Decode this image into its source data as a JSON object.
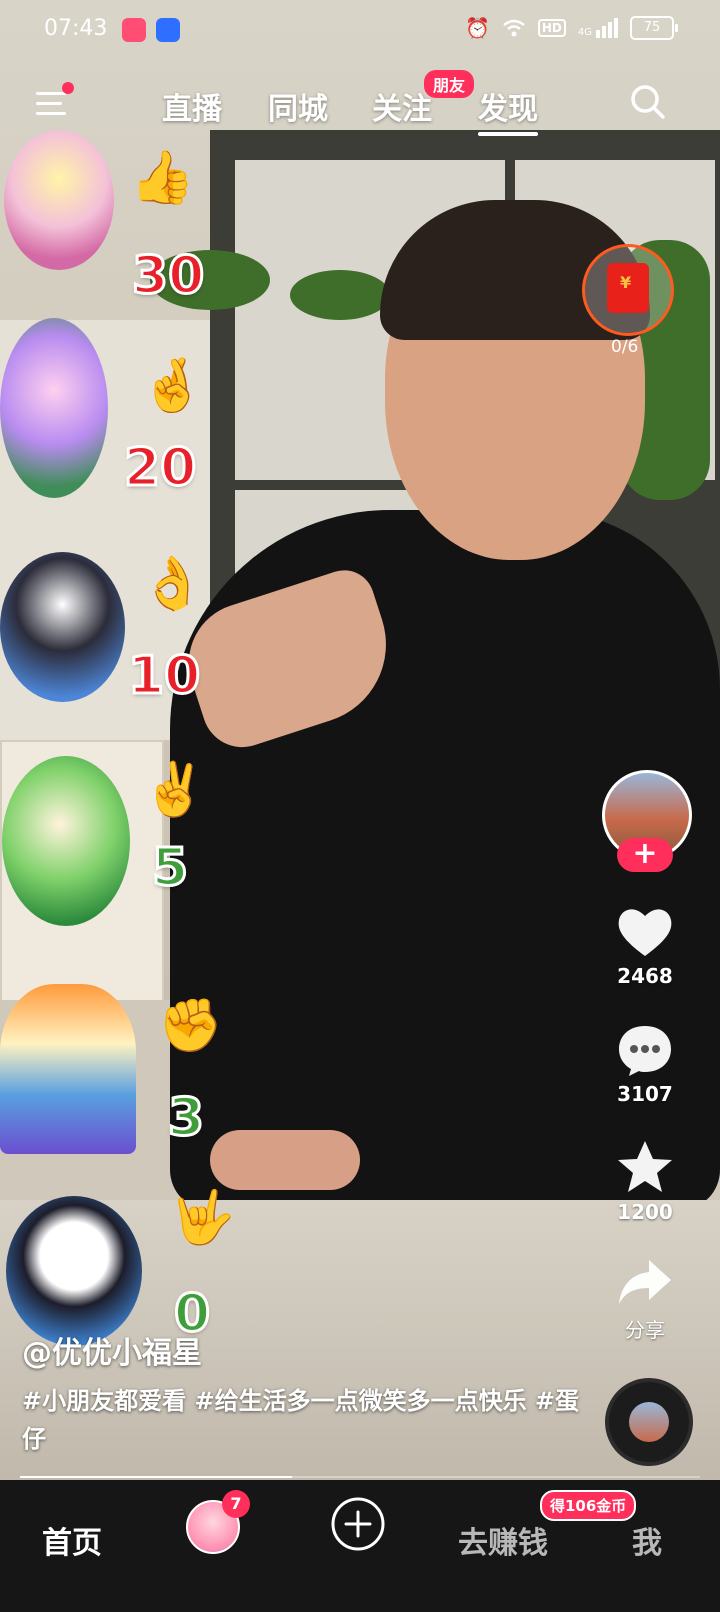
{
  "status_bar": {
    "time": "07:43",
    "battery": "75",
    "network": "4G",
    "hd_label": "HD",
    "icons": [
      "app-icon-bilibili",
      "app-icon-baidu",
      "alarm-icon",
      "wifi-icon",
      "signal-icon"
    ]
  },
  "top_nav": {
    "tabs": [
      {
        "label": "直播",
        "active": false
      },
      {
        "label": "同城",
        "active": false
      },
      {
        "label": "关注",
        "active": false
      },
      {
        "label": "发现",
        "active": true
      }
    ],
    "friend_badge": "朋友"
  },
  "stickers": {
    "counts": [
      "30",
      "20",
      "10",
      "5",
      "3",
      "0"
    ],
    "count_colors": [
      "#e8202a",
      "#e8202a",
      "#e8202a",
      "#3f9e3a",
      "#3f9e3a",
      "#3f9e3a"
    ],
    "hand_emojis": [
      "👍",
      "🤞",
      "👌",
      "✌️",
      "✊",
      "🤟"
    ]
  },
  "red_packet": {
    "progress": "0/6"
  },
  "actions": {
    "likes": "2468",
    "comments": "3107",
    "favorites": "1200",
    "share_label": "分享"
  },
  "video": {
    "author": "@优优小福星",
    "caption": "#小朋友都爱看 #给生活多一点微笑多一点快乐 #蛋仔",
    "progress": 0.4
  },
  "bottom_nav": {
    "home": "首页",
    "inbox_badge": "7",
    "earn": "去赚钱",
    "earn_badge": "得106金币",
    "me": "我"
  },
  "colors": {
    "accent": "#ff2e5b",
    "red_packet_ring": "#ff5a1f"
  }
}
